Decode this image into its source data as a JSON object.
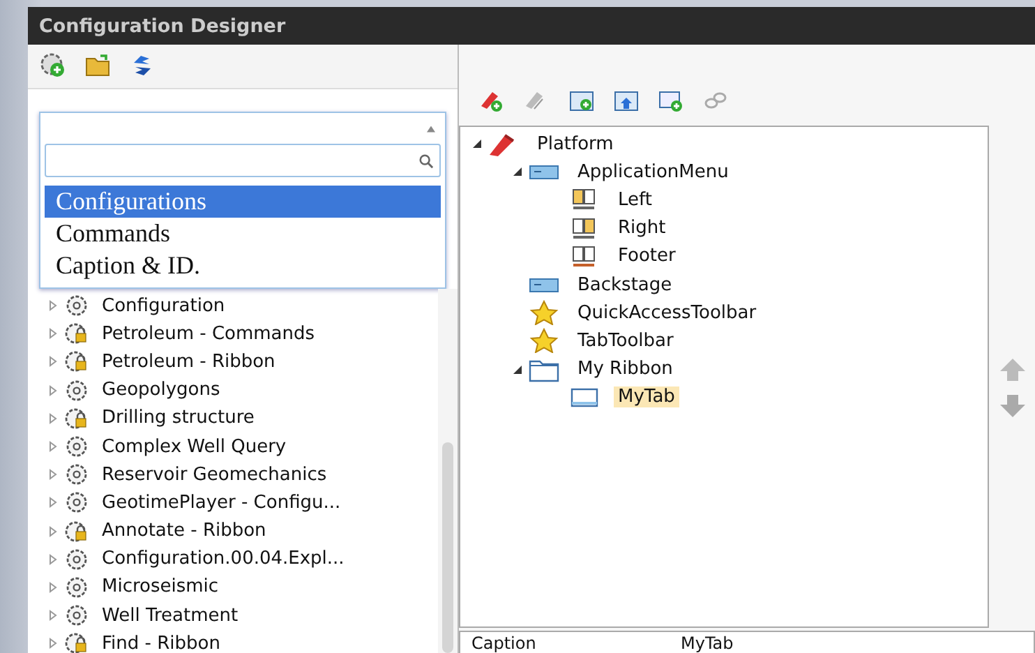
{
  "window": {
    "title": "Configuration Designer"
  },
  "dropdown": {
    "expanded": true,
    "options": [
      {
        "label": "Configurations",
        "selected": true
      },
      {
        "label": "Commands",
        "selected": false
      },
      {
        "label": "Caption & ID.",
        "selected": false
      }
    ]
  },
  "configurations": [
    {
      "label": "Configuration",
      "kind": "gear",
      "expanded": false
    },
    {
      "label": "Petroleum - Commands",
      "kind": "locked",
      "expanded": false
    },
    {
      "label": "Petroleum - Ribbon",
      "kind": "locked",
      "expanded": false
    },
    {
      "label": "Geopolygons",
      "kind": "gear",
      "expanded": false
    },
    {
      "label": "Drilling structure",
      "kind": "locked",
      "expanded": false
    },
    {
      "label": "Complex Well Query",
      "kind": "gear",
      "expanded": false
    },
    {
      "label": "Reservoir Geomechanics",
      "kind": "gear",
      "expanded": false
    },
    {
      "label": "GeotimePlayer - Configu...",
      "kind": "gear",
      "expanded": false
    },
    {
      "label": "Annotate - Ribbon",
      "kind": "locked",
      "expanded": false
    },
    {
      "label": "Configuration.00.04.Expl...",
      "kind": "gear",
      "expanded": false
    },
    {
      "label": "Microseismic",
      "kind": "gear",
      "expanded": false
    },
    {
      "label": "Well Treatment",
      "kind": "gear",
      "expanded": false
    },
    {
      "label": "Find - Ribbon",
      "kind": "locked",
      "expanded": false
    }
  ],
  "tree": [
    {
      "label": "Platform",
      "kind": "pin",
      "expanded": true,
      "selected": false,
      "children": [
        {
          "label": "ApplicationMenu",
          "kind": "panel",
          "expanded": true,
          "selected": false,
          "children": [
            {
              "label": "Left",
              "kind": "column-left",
              "selected": false
            },
            {
              "label": "Right",
              "kind": "column-right",
              "selected": false
            },
            {
              "label": "Footer",
              "kind": "column-footer",
              "selected": false
            }
          ]
        },
        {
          "label": "Backstage",
          "kind": "panel",
          "selected": false
        },
        {
          "label": "QuickAccessToolbar",
          "kind": "star",
          "selected": false
        },
        {
          "label": "TabToolbar",
          "kind": "star",
          "selected": false
        },
        {
          "label": "My Ribbon",
          "kind": "folder",
          "expanded": true,
          "selected": false,
          "children": [
            {
              "label": "MyTab",
              "kind": "tab",
              "selected": true
            }
          ]
        }
      ]
    }
  ],
  "properties": [
    {
      "name": "Caption",
      "value": "MyTab"
    }
  ]
}
